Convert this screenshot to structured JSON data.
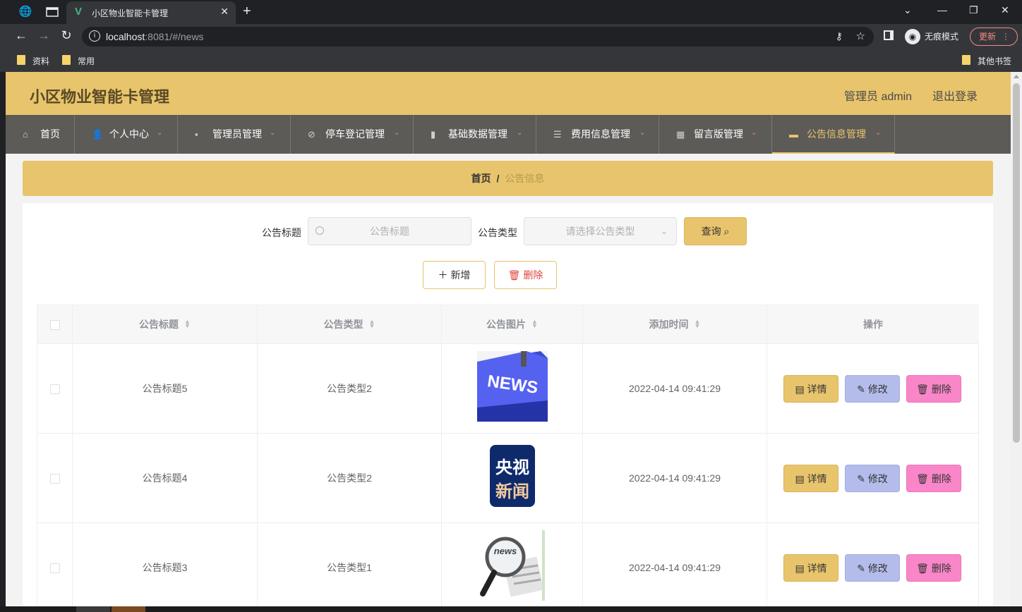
{
  "browser": {
    "tab_title": "小区物业智能卡管理",
    "url_host": "localhost",
    "url_rest": ":8081/#/news",
    "incognito_label": "无痕模式",
    "update_label": "更新",
    "bookmarks": [
      "资料",
      "常用"
    ],
    "other_bookmarks": "其他书签"
  },
  "header": {
    "brand": "小区物业智能卡管理",
    "user": "管理员 admin",
    "logout": "退出登录"
  },
  "menu": [
    {
      "label": "首页",
      "icon": "home-icon"
    },
    {
      "label": "个人中心",
      "icon": "user-icon"
    },
    {
      "label": "管理员管理",
      "icon": "chat-icon"
    },
    {
      "label": "停车登记管理",
      "icon": "bell-off-icon"
    },
    {
      "label": "基础数据管理",
      "icon": "mic-icon"
    },
    {
      "label": "费用信息管理",
      "icon": "sliders-icon"
    },
    {
      "label": "留言版管理",
      "icon": "chart-icon"
    },
    {
      "label": "公告信息管理",
      "icon": "monitor-icon",
      "active": true
    }
  ],
  "breadcrumb": {
    "home": "首页",
    "separator": "/",
    "current": "公告信息"
  },
  "filters": {
    "title_label": "公告标题",
    "title_placeholder": "公告标题",
    "type_label": "公告类型",
    "type_placeholder": "请选择公告类型",
    "query_label": "查询"
  },
  "actions": {
    "add_label": "新增",
    "delete_label": "删除"
  },
  "table": {
    "headers": [
      "公告标题",
      "公告类型",
      "公告图片",
      "添加时间",
      "操作"
    ],
    "row_buttons": {
      "detail": "详情",
      "edit": "修改",
      "delete": "删除"
    },
    "rows": [
      {
        "title": "公告标题5",
        "type": "公告类型2",
        "image": "news-keyboard-image",
        "time": "2022-04-14 09:41:29"
      },
      {
        "title": "公告标题4",
        "type": "公告类型2",
        "image": "cctv-news-logo",
        "time": "2022-04-14 09:41:29"
      },
      {
        "title": "公告标题3",
        "type": "公告类型1",
        "image": "newspaper-magnifier-image",
        "time": "2022-04-14 09:41:29"
      }
    ]
  },
  "image_text": {
    "news": "NEWS",
    "cctv_top": "央视",
    "cctv_bottom": "新闻",
    "small_news": "news"
  },
  "colors": {
    "accent": "#e8c46c",
    "menu_bg": "#5d5b58",
    "edit": "#b3bcea",
    "danger": "#f986c8"
  }
}
